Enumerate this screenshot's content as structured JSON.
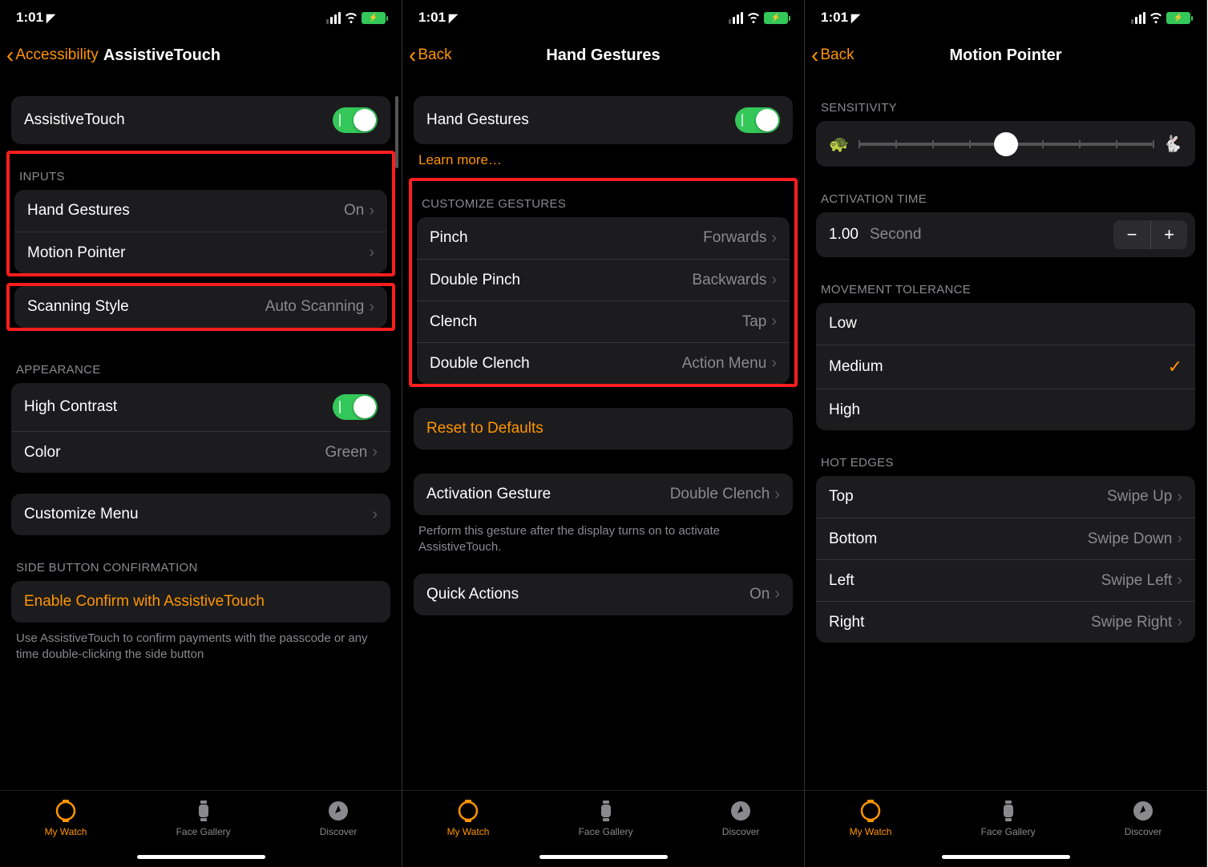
{
  "status": {
    "time": "1:01",
    "locationIcon": "➤",
    "wifiIcon": "wifi",
    "batteryCharging": true
  },
  "tabs": {
    "myWatch": "My Watch",
    "faceGallery": "Face Gallery",
    "discover": "Discover"
  },
  "screen1": {
    "back": "Accessibility",
    "title": "AssistiveTouch",
    "mainToggle": "AssistiveTouch",
    "inputsHeader": "INPUTS",
    "handGestures": {
      "label": "Hand Gestures",
      "value": "On"
    },
    "motionPointer": {
      "label": "Motion Pointer"
    },
    "scanningStyle": {
      "label": "Scanning Style",
      "value": "Auto Scanning"
    },
    "appearanceHeader": "APPEARANCE",
    "highContrast": "High Contrast",
    "color": {
      "label": "Color",
      "value": "Green"
    },
    "customizeMenu": "Customize Menu",
    "sideButtonHeader": "SIDE BUTTON CONFIRMATION",
    "enableConfirm": "Enable Confirm with AssistiveTouch",
    "confirmFooter": "Use AssistiveTouch to confirm payments with the passcode or any time double-clicking the side button"
  },
  "screen2": {
    "back": "Back",
    "title": "Hand Gestures",
    "mainToggle": "Hand Gestures",
    "learnMore": "Learn more…",
    "customizeHeader": "CUSTOMIZE GESTURES",
    "pinch": {
      "label": "Pinch",
      "value": "Forwards"
    },
    "doublePinch": {
      "label": "Double Pinch",
      "value": "Backwards"
    },
    "clench": {
      "label": "Clench",
      "value": "Tap"
    },
    "doubleClench": {
      "label": "Double Clench",
      "value": "Action Menu"
    },
    "reset": "Reset to Defaults",
    "activationGesture": {
      "label": "Activation Gesture",
      "value": "Double Clench"
    },
    "activationFooter": "Perform this gesture after the display turns on to activate AssistiveTouch.",
    "quickActions": {
      "label": "Quick Actions",
      "value": "On"
    }
  },
  "screen3": {
    "back": "Back",
    "title": "Motion Pointer",
    "sensitivityHeader": "SENSITIVITY",
    "sensitivityValue": 0.5,
    "activationTimeHeader": "ACTIVATION TIME",
    "activationTime": {
      "value": "1.00",
      "unit": "Second"
    },
    "movementToleranceHeader": "MOVEMENT TOLERANCE",
    "tolerance": {
      "low": "Low",
      "medium": "Medium",
      "high": "High",
      "selected": "Medium"
    },
    "hotEdgesHeader": "HOT EDGES",
    "hotEdges": {
      "top": {
        "label": "Top",
        "value": "Swipe Up"
      },
      "bottom": {
        "label": "Bottom",
        "value": "Swipe Down"
      },
      "left": {
        "label": "Left",
        "value": "Swipe Left"
      },
      "right": {
        "label": "Right",
        "value": "Swipe Right"
      }
    }
  }
}
